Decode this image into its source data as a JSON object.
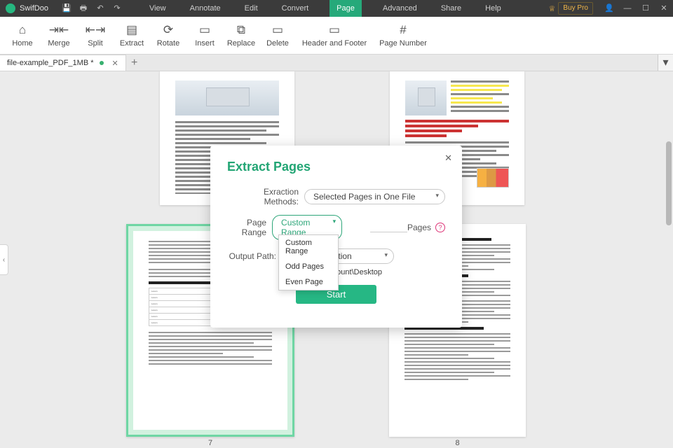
{
  "app": {
    "brand": "SwifDoo"
  },
  "titlebar": {
    "buttons": {
      "save": "💾",
      "print": "🖶",
      "undo": "↶",
      "redo": "↷"
    },
    "menus": [
      "View",
      "Annotate",
      "Edit",
      "Convert",
      "Page",
      "Advanced",
      "Share",
      "Help"
    ],
    "active_menu": "Page",
    "buy_pro": "Buy Pro"
  },
  "ribbon": [
    {
      "id": "home",
      "label": "Home",
      "icon": "⌂"
    },
    {
      "id": "merge",
      "label": "Merge",
      "icon": "⇥⇤"
    },
    {
      "id": "split",
      "label": "Split",
      "icon": "⇤⇥"
    },
    {
      "id": "extract",
      "label": "Extract",
      "icon": "▤"
    },
    {
      "id": "rotate",
      "label": "Rotate",
      "icon": "⟳"
    },
    {
      "id": "insert",
      "label": "Insert",
      "icon": "▭"
    },
    {
      "id": "replace",
      "label": "Replace",
      "icon": "⧉"
    },
    {
      "id": "delete",
      "label": "Delete",
      "icon": "▭"
    },
    {
      "id": "header-footer",
      "label": "Header and Footer",
      "icon": "▭"
    },
    {
      "id": "page-number",
      "label": "Page Number",
      "icon": "#"
    }
  ],
  "tab": {
    "name": "file-example_PDF_1MB *"
  },
  "pages": {
    "p7": "7",
    "p8": "8"
  },
  "dialog": {
    "title": "Extract Pages",
    "method_label": "Exraction Methods:",
    "method_value": "Selected Pages in One File",
    "range_label": "Page Range",
    "range_value": "Custom Range",
    "pages_label": "Pages",
    "output_label": "Output Path:",
    "output_value": "Source Location",
    "output_path": "C:\\Users\\Account\\Desktop",
    "start": "Start",
    "dropdown": [
      "Custom Range",
      "Odd Pages",
      "Even Page"
    ]
  },
  "colors": {
    "accent": "#26b784"
  }
}
